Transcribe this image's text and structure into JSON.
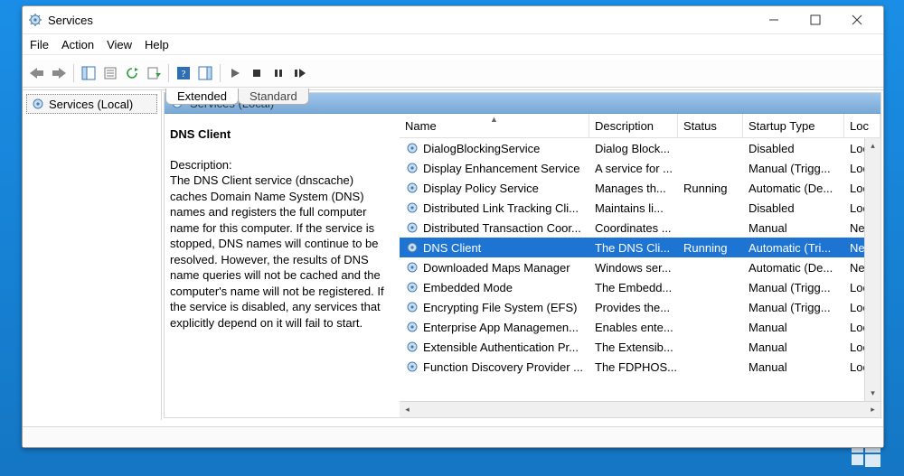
{
  "window": {
    "title": "Services"
  },
  "menu": {
    "file": "File",
    "action": "Action",
    "view": "View",
    "help": "Help"
  },
  "nav": {
    "item": "Services (Local)"
  },
  "content_header": "Services (Local)",
  "detail": {
    "name": "DNS Client",
    "desc_label": "Description:",
    "desc": "The DNS Client service (dnscache) caches Domain Name System (DNS) names and registers the full computer name for this computer. If the service is stopped, DNS names will continue to be resolved. However, the results of DNS name queries will not be cached and the computer's name will not be registered. If the service is disabled, any services that explicitly depend on it will fail to start."
  },
  "columns": {
    "c0": "Name",
    "c1": "Description",
    "c2": "Status",
    "c3": "Startup Type",
    "c4": "Loc"
  },
  "rows": [
    {
      "name": "DialogBlockingService",
      "desc": "Dialog Block...",
      "status": "",
      "startup": "Disabled",
      "logon": "Loc",
      "sel": false
    },
    {
      "name": "Display Enhancement Service",
      "desc": "A service for ...",
      "status": "",
      "startup": "Manual (Trigg...",
      "logon": "Loc",
      "sel": false
    },
    {
      "name": "Display Policy Service",
      "desc": "Manages th...",
      "status": "Running",
      "startup": "Automatic (De...",
      "logon": "Loc",
      "sel": false
    },
    {
      "name": "Distributed Link Tracking Cli...",
      "desc": "Maintains li...",
      "status": "",
      "startup": "Disabled",
      "logon": "Loc",
      "sel": false
    },
    {
      "name": "Distributed Transaction Coor...",
      "desc": "Coordinates ...",
      "status": "",
      "startup": "Manual",
      "logon": "Ne",
      "sel": false
    },
    {
      "name": "DNS Client",
      "desc": "The DNS Cli...",
      "status": "Running",
      "startup": "Automatic (Tri...",
      "logon": "Ne",
      "sel": true
    },
    {
      "name": "Downloaded Maps Manager",
      "desc": "Windows ser...",
      "status": "",
      "startup": "Automatic (De...",
      "logon": "Ne",
      "sel": false
    },
    {
      "name": "Embedded Mode",
      "desc": "The Embedd...",
      "status": "",
      "startup": "Manual (Trigg...",
      "logon": "Loc",
      "sel": false
    },
    {
      "name": "Encrypting File System (EFS)",
      "desc": "Provides the...",
      "status": "",
      "startup": "Manual (Trigg...",
      "logon": "Loc",
      "sel": false
    },
    {
      "name": "Enterprise App Managemen...",
      "desc": "Enables ente...",
      "status": "",
      "startup": "Manual",
      "logon": "Loc",
      "sel": false
    },
    {
      "name": "Extensible Authentication Pr...",
      "desc": "The Extensib...",
      "status": "",
      "startup": "Manual",
      "logon": "Loc",
      "sel": false
    },
    {
      "name": "Function Discovery Provider ...",
      "desc": "The FDPHOS...",
      "status": "",
      "startup": "Manual",
      "logon": "Loc",
      "sel": false
    }
  ],
  "tabs": {
    "extended": "Extended",
    "standard": "Standard"
  }
}
